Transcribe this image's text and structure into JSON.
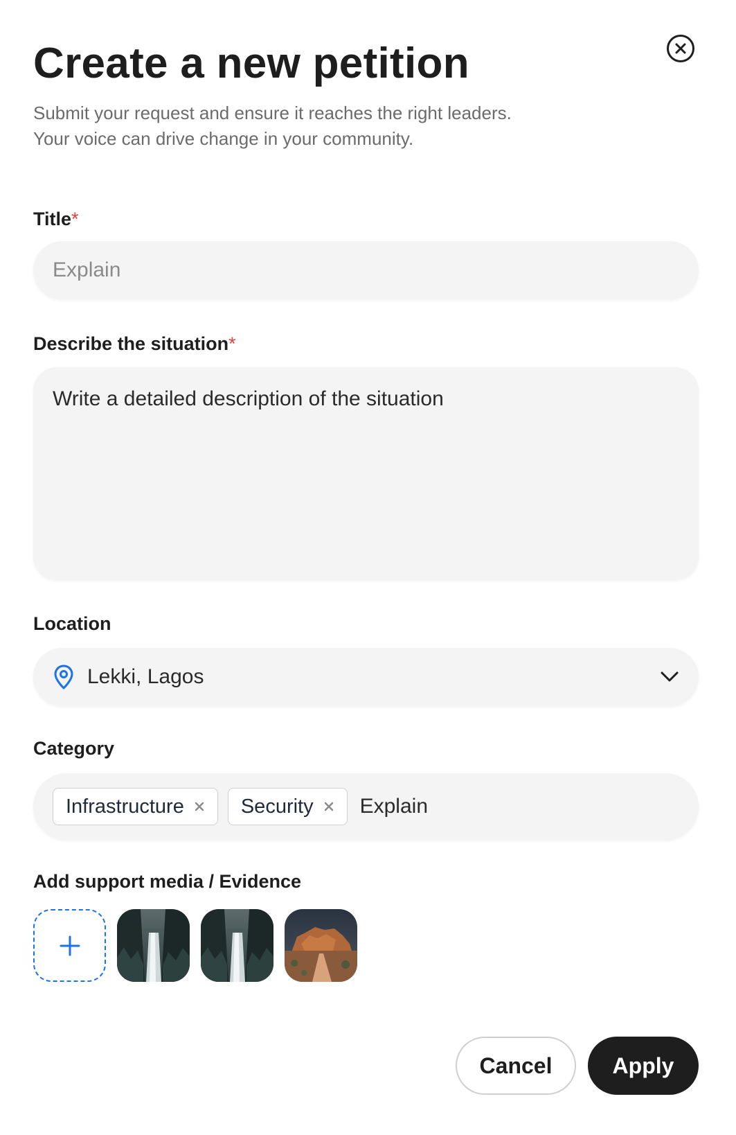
{
  "dialog": {
    "title": "Create a new petition",
    "subtitle_line1": "Submit your request and ensure it reaches the right leaders.",
    "subtitle_line2": "Your voice can drive change in your community.",
    "close_icon": "close-circle-icon"
  },
  "form": {
    "title_field": {
      "label": "Title",
      "required_mark": "*",
      "placeholder": "Explain"
    },
    "description_field": {
      "label": "Describe the situation",
      "required_mark": "*",
      "placeholder": "Write a detailed description of the situation"
    },
    "location_field": {
      "label": "Location",
      "value": "Lekki, Lagos",
      "icon": "location-pin-icon",
      "dropdown_icon": "chevron-down-icon"
    },
    "category_field": {
      "label": "Category",
      "tags": [
        {
          "label": "Infrastructure"
        },
        {
          "label": "Security"
        }
      ],
      "placeholder": "Explain"
    },
    "media_field": {
      "label": "Add support media / Evidence",
      "add_icon": "plus-icon",
      "thumbnails": [
        {
          "kind": "waterfall-photo"
        },
        {
          "kind": "waterfall-photo"
        },
        {
          "kind": "desert-rock-photo"
        }
      ]
    }
  },
  "actions": {
    "cancel_label": "Cancel",
    "apply_label": "Apply"
  },
  "colors": {
    "accent_blue": "#1a73e8",
    "required_red": "#e0413a",
    "primary_dark": "#1e1e1e",
    "field_bg": "#f4f4f4"
  }
}
